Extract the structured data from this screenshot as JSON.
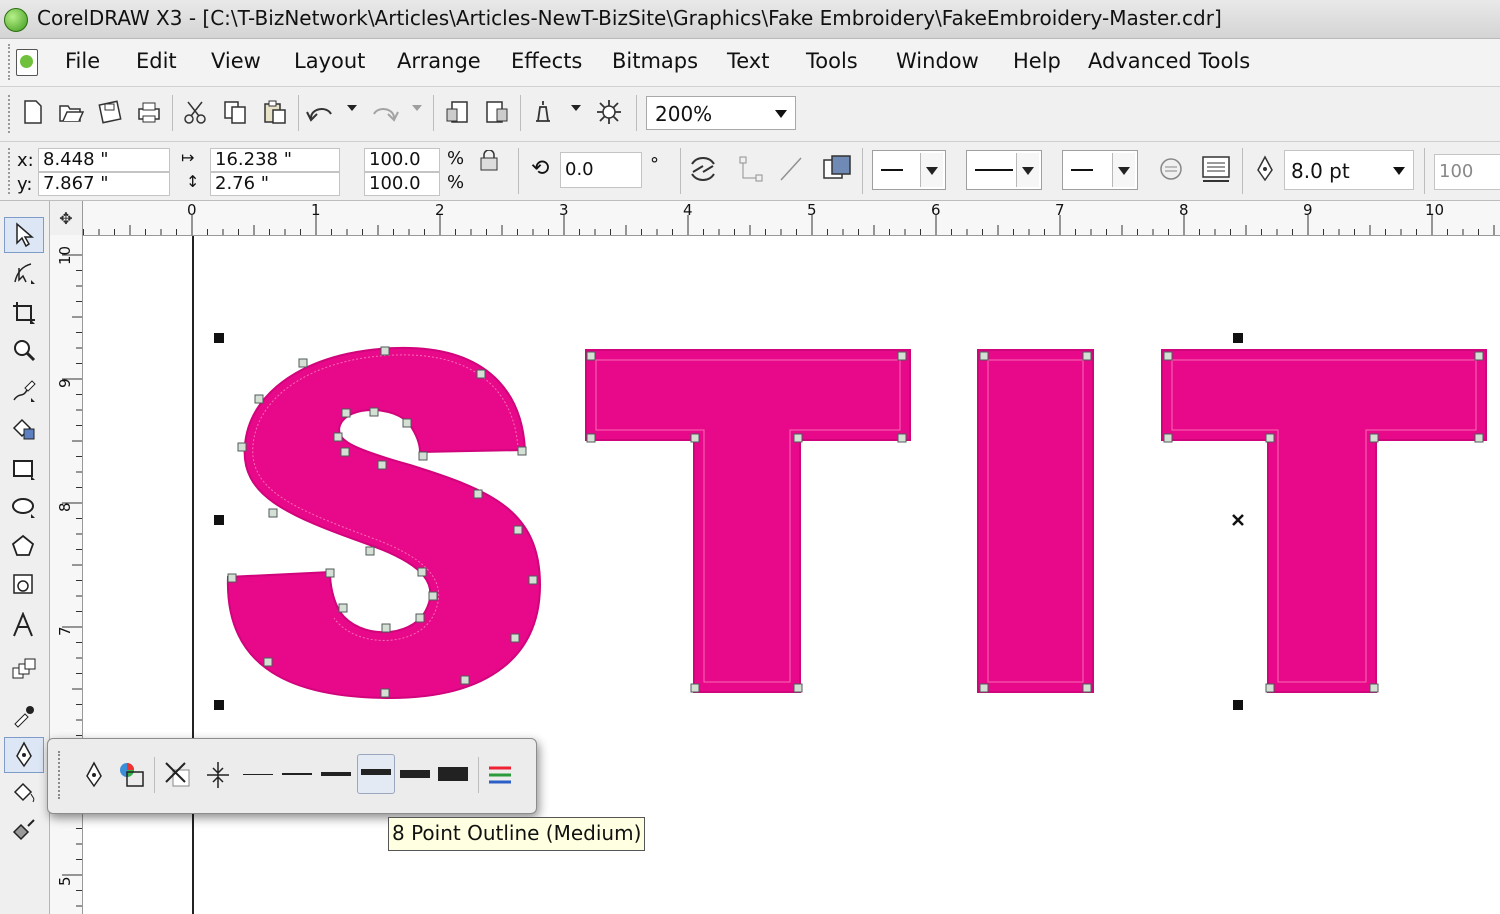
{
  "window": {
    "title": "CorelDRAW X3 - [C:\\T-BizNetwork\\Articles\\Articles-NewT-BizSite\\Graphics\\Fake Embroidery\\FakeEmbroidery-Master.cdr]"
  },
  "menu": {
    "items": [
      "File",
      "Edit",
      "View",
      "Layout",
      "Arrange",
      "Effects",
      "Bitmaps",
      "Text",
      "Tools",
      "Window",
      "Help",
      "Advanced Tools"
    ]
  },
  "toolbar": {
    "zoom_value": "200%",
    "icons": [
      "new-icon",
      "open-icon",
      "save-icon",
      "print-icon",
      "cut-icon",
      "copy-icon",
      "paste-icon",
      "undo-icon",
      "redo-icon",
      "import-icon",
      "export-icon",
      "application-launcher-icon",
      "welcome-screen-icon"
    ]
  },
  "propbar": {
    "x_label": "x:",
    "x_value": "8.448 \"",
    "y_label": "y:",
    "y_value": "7.867 \"",
    "width_value": "16.238 \"",
    "height_value": "2.76 \"",
    "scale_x": "100.0",
    "scale_y": "100.0",
    "percent": "%",
    "rotation": "0.0",
    "degree": "°",
    "outline_width": "8.0 pt",
    "extra_value": "100"
  },
  "ruler": {
    "h_labels": [
      "0",
      "1",
      "2",
      "3",
      "4",
      "5",
      "6",
      "7",
      "8",
      "9",
      "10"
    ],
    "v_labels": [
      "10",
      "9",
      "8",
      "7",
      "5"
    ]
  },
  "toolbox": {
    "tools": [
      "pick-tool-icon",
      "shape-tool-icon",
      "crop-tool-icon",
      "zoom-tool-icon",
      "freehand-tool-icon",
      "smart-fill-tool-icon",
      "rectangle-tool-icon",
      "ellipse-tool-icon",
      "polygon-tool-icon",
      "basic-shapes-tool-icon",
      "text-tool-icon",
      "interactive-blend-tool-icon",
      "eyedropper-tool-icon",
      "outline-tool-icon",
      "fill-tool-icon",
      "interactive-fill-tool-icon"
    ]
  },
  "canvas": {
    "letters_text": "STIT",
    "fill_color": "#e8088a"
  },
  "flyout": {
    "tooltip": "8 Point Outline (Medium)",
    "buttons": [
      "outline-pen-icon",
      "outline-color-icon",
      "no-outline-icon",
      "hairline-outline-icon",
      "half-point-outline-icon",
      "one-point-outline-icon",
      "two-point-outline-icon",
      "eight-point-outline-icon",
      "sixteen-point-outline-icon",
      "twenty-four-point-outline-icon",
      "color-docker-icon"
    ]
  }
}
